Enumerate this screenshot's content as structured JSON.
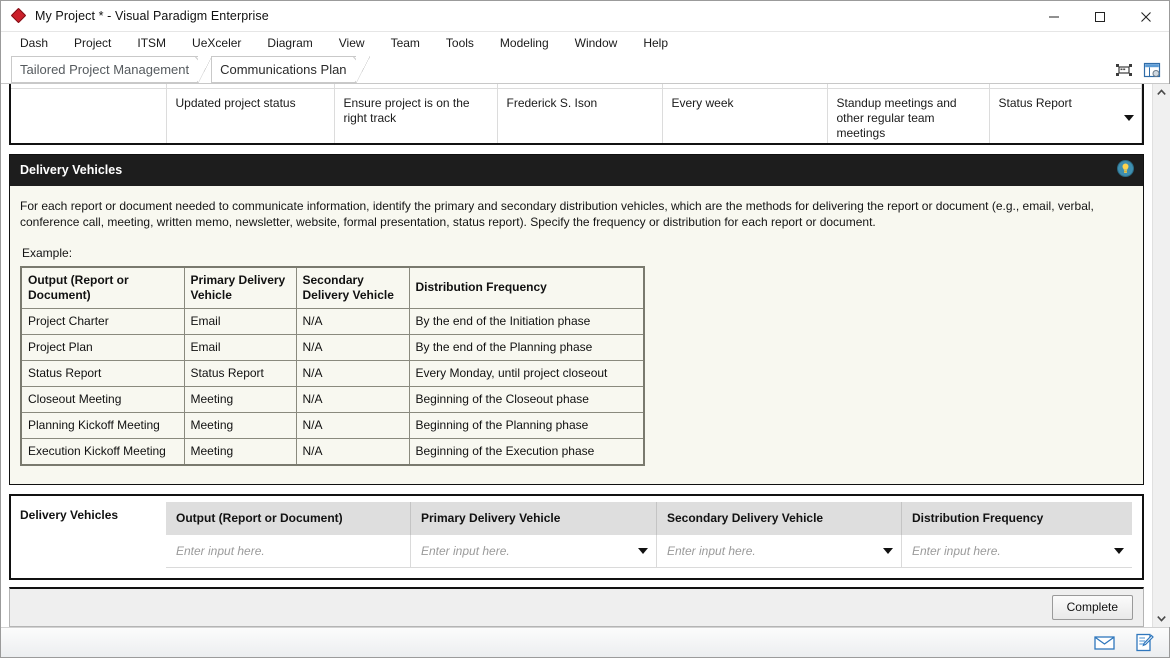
{
  "window": {
    "title": "My Project * - Visual Paradigm Enterprise",
    "logo_icon": "visual-paradigm-diamond-icon",
    "minimize_icon": "minimize-icon",
    "maximize_icon": "maximize-icon",
    "close_icon": "close-icon"
  },
  "menubar": {
    "items": [
      {
        "label": "Dash"
      },
      {
        "label": "Project"
      },
      {
        "label": "ITSM"
      },
      {
        "label": "UeXceler"
      },
      {
        "label": "Diagram"
      },
      {
        "label": "View"
      },
      {
        "label": "Team"
      },
      {
        "label": "Tools"
      },
      {
        "label": "Modeling"
      },
      {
        "label": "Window"
      },
      {
        "label": "Help"
      }
    ]
  },
  "breadcrumb": {
    "items": [
      {
        "label": "Tailored Project Management"
      },
      {
        "label": "Communications Plan"
      }
    ],
    "tools": [
      {
        "icon": "fit-to-screen-icon"
      },
      {
        "icon": "open-in-window-icon"
      }
    ]
  },
  "top_table": {
    "row": {
      "col1": "",
      "col2": "Updated project status",
      "col3": "Ensure project is on the right track",
      "col4": "Frederick S. Ison",
      "col5": "Every week",
      "col6": "Standup meetings and other regular team meetings",
      "col7": "Status Report"
    },
    "dropdown_icon": "chevron-down-icon"
  },
  "section": {
    "title": "Delivery Vehicles",
    "hint_icon": "lightbulb-hint-icon",
    "description": "For each report or document needed to communicate information, identify the primary and secondary distribution vehicles, which are the methods for delivering the report or document (e.g., email, verbal, conference call, meeting, written memo, newsletter, website, formal presentation, status report). Specify the frequency or distribution for each report or document.",
    "example_label": "Example:",
    "example_table": {
      "headers": [
        "Output (Report or Document)",
        "Primary Delivery Vehicle",
        "Secondary Delivery Vehicle",
        "Distribution Frequency"
      ],
      "rows": [
        [
          "Project Charter",
          "Email",
          "N/A",
          "By the end of the Initiation phase"
        ],
        [
          "Project Plan",
          "Email",
          "N/A",
          "By the end of the Planning phase"
        ],
        [
          "Status Report",
          "Status Report",
          "N/A",
          "Every Monday, until project closeout"
        ],
        [
          "Closeout Meeting",
          "Meeting",
          "N/A",
          "Beginning of the Closeout phase"
        ],
        [
          "Planning Kickoff Meeting",
          "Meeting",
          "N/A",
          "Beginning of the Planning phase"
        ],
        [
          "Execution Kickoff Meeting",
          "Meeting",
          "N/A",
          "Beginning of the Execution phase"
        ]
      ]
    }
  },
  "form": {
    "label": "Delivery Vehicles",
    "headers": [
      "Output (Report or Document)",
      "Primary Delivery Vehicle",
      "Secondary Delivery Vehicle",
      "Distribution Frequency"
    ],
    "row": {
      "output_value": "",
      "output_placeholder": "Enter input here.",
      "primary_value": "",
      "primary_placeholder": "Enter input here.",
      "secondary_value": "",
      "secondary_placeholder": "Enter input here.",
      "frequency_value": "",
      "frequency_placeholder": "Enter input here."
    },
    "dropdown_icon": "chevron-down-icon"
  },
  "actions": {
    "complete_label": "Complete"
  },
  "scrollbar": {
    "up_icon": "scroll-up-icon",
    "down_icon": "scroll-down-icon"
  },
  "statusbar": {
    "icons": [
      {
        "icon": "mail-envelope-icon"
      },
      {
        "icon": "edit-document-icon"
      }
    ]
  },
  "colors": {
    "section_header_bg": "#1d1d1d",
    "content_bg": "#f8f8f0",
    "accent_red": "#cb1f2a",
    "form_header_bg": "#dedede"
  }
}
